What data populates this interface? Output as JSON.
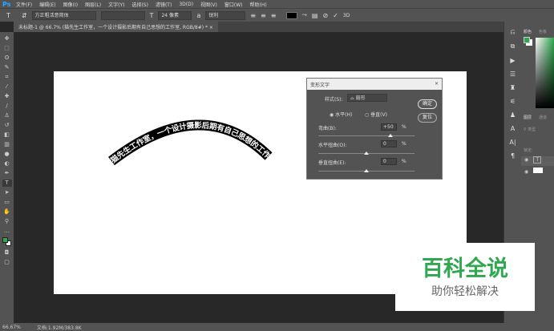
{
  "menubar": {
    "logo": "Ps",
    "items": [
      "文件(F)",
      "编辑(E)",
      "图像(I)",
      "图层(L)",
      "文字(Y)",
      "选择(S)",
      "滤镜(T)",
      "3D(D)",
      "视图(V)",
      "窗口(W)",
      "帮助(H)"
    ]
  },
  "options": {
    "font_family": "方正粗活意简体",
    "font_size": "24 像素",
    "antialias": "锐利",
    "text_color": "#000000",
    "btn_3d": "3D"
  },
  "tab": {
    "title": "未标题-1 @ 66.7% (猫先生工作室，一个设计摄影后期有自己思想的工作室, RGB/8#) *",
    "close": "×"
  },
  "canvas": {
    "warped_text": "猫先生工作室，一个设计摄影后期有自己思想的工作室"
  },
  "dialog": {
    "title": "变形文字",
    "close": "×",
    "style_label": "样式(S):",
    "style_value": "扇形",
    "horizontal": "水平(H)",
    "vertical": "垂直(V)",
    "bend_label": "弯曲(B):",
    "bend_value": "+50",
    "hdist_label": "水平扭曲(O):",
    "hdist_value": "0",
    "vdist_label": "垂直扭曲(E):",
    "vdist_value": "0",
    "percent": "%",
    "ok": "确定",
    "reset": "复位",
    "bend": 50,
    "hdist": 0,
    "vdist": 0
  },
  "right_panel": {
    "color_tab": "颜色",
    "swatch_tab": "色板",
    "layers_tab": "图层",
    "channels_tab": "通道",
    "kind": "类型",
    "lock": "锁定:",
    "fg_color": "#2fa84f",
    "bg_color": "#ffffff"
  },
  "status": {
    "zoom": "66.67%",
    "doc": "文档:1.92M/383.8K"
  },
  "watermark": {
    "title": "百科全说",
    "subtitle": "助你轻松解决",
    "color": "#2fa84f"
  }
}
